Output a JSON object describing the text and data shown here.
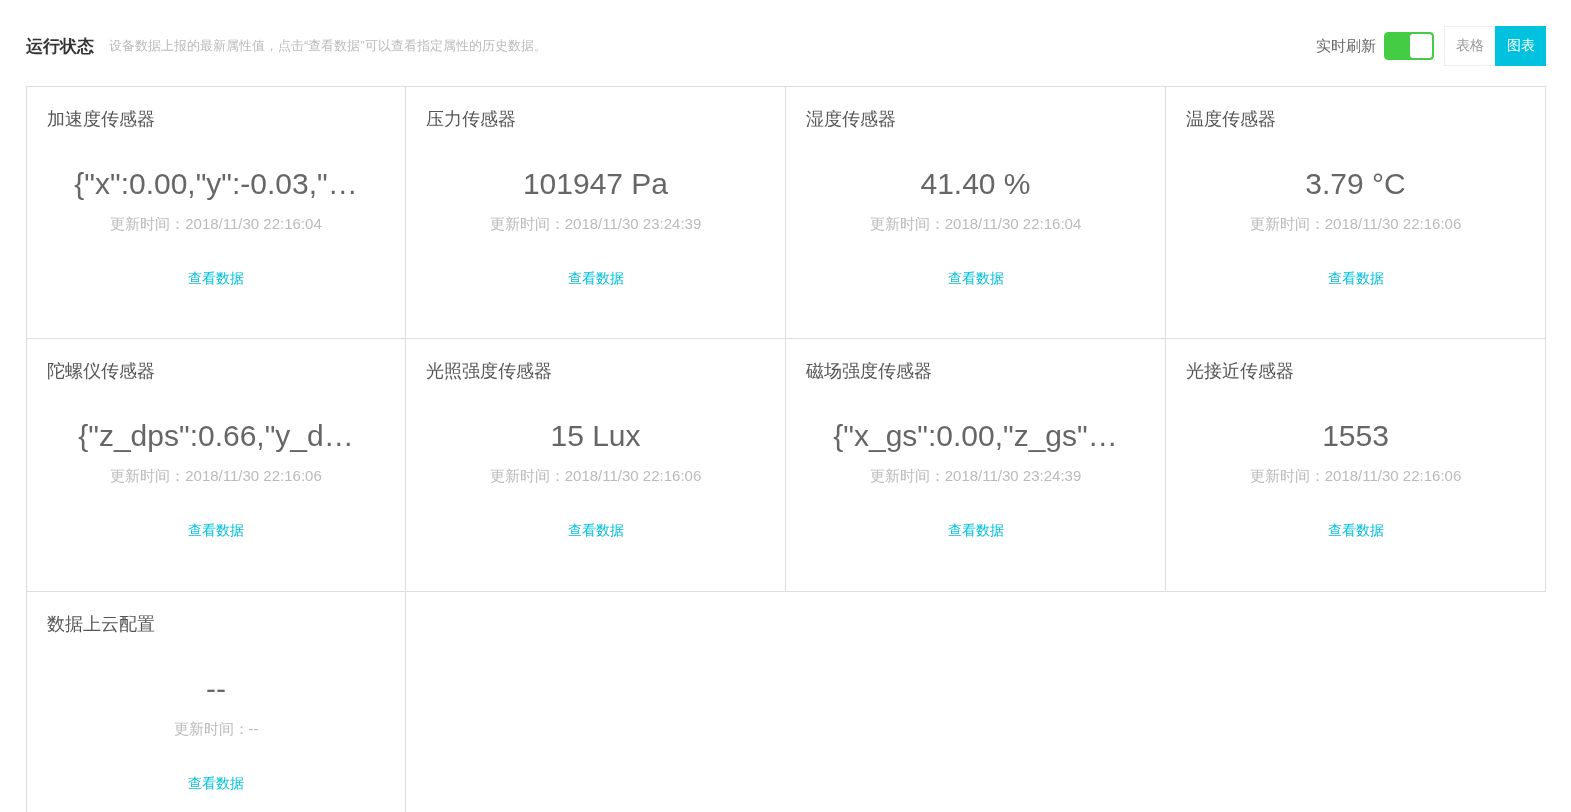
{
  "header": {
    "title": "运行状态",
    "description": "设备数据上报的最新属性值，点击“查看数据”可以查看指定属性的历史数据。",
    "refresh": {
      "label": "实时刷新",
      "on": true
    },
    "views": [
      {
        "label": "表格",
        "selected": false
      },
      {
        "label": "图表",
        "selected": true
      }
    ]
  },
  "cards": [
    {
      "name": "加速度传感器",
      "value": "{\"x\":0.00,\"y\":-0.03,\"…",
      "updated": "更新时间：2018/11/30 22:16:04",
      "link": "查看数据"
    },
    {
      "name": "压力传感器",
      "value": "101947 Pa",
      "updated": "更新时间：2018/11/30 23:24:39",
      "link": "查看数据"
    },
    {
      "name": "湿度传感器",
      "value": "41.40 %",
      "updated": "更新时间：2018/11/30 22:16:04",
      "link": "查看数据"
    },
    {
      "name": "温度传感器",
      "value": "3.79 °C",
      "updated": "更新时间：2018/11/30 22:16:06",
      "link": "查看数据"
    },
    {
      "name": "陀螺仪传感器",
      "value": "{\"z_dps\":0.66,\"y_d…",
      "updated": "更新时间：2018/11/30 22:16:06",
      "link": "查看数据"
    },
    {
      "name": "光照强度传感器",
      "value": "15 Lux",
      "updated": "更新时间：2018/11/30 22:16:06",
      "link": "查看数据"
    },
    {
      "name": "磁场强度传感器",
      "value": "{\"x_gs\":0.00,\"z_gs\"…",
      "updated": "更新时间：2018/11/30 23:24:39",
      "link": "查看数据"
    },
    {
      "name": "光接近传感器",
      "value": "1553",
      "updated": "更新时间：2018/11/30 22:16:06",
      "link": "查看数据"
    },
    {
      "name": "数据上云配置",
      "value": "--",
      "updated": "更新时间：--",
      "link": "查看数据"
    }
  ]
}
